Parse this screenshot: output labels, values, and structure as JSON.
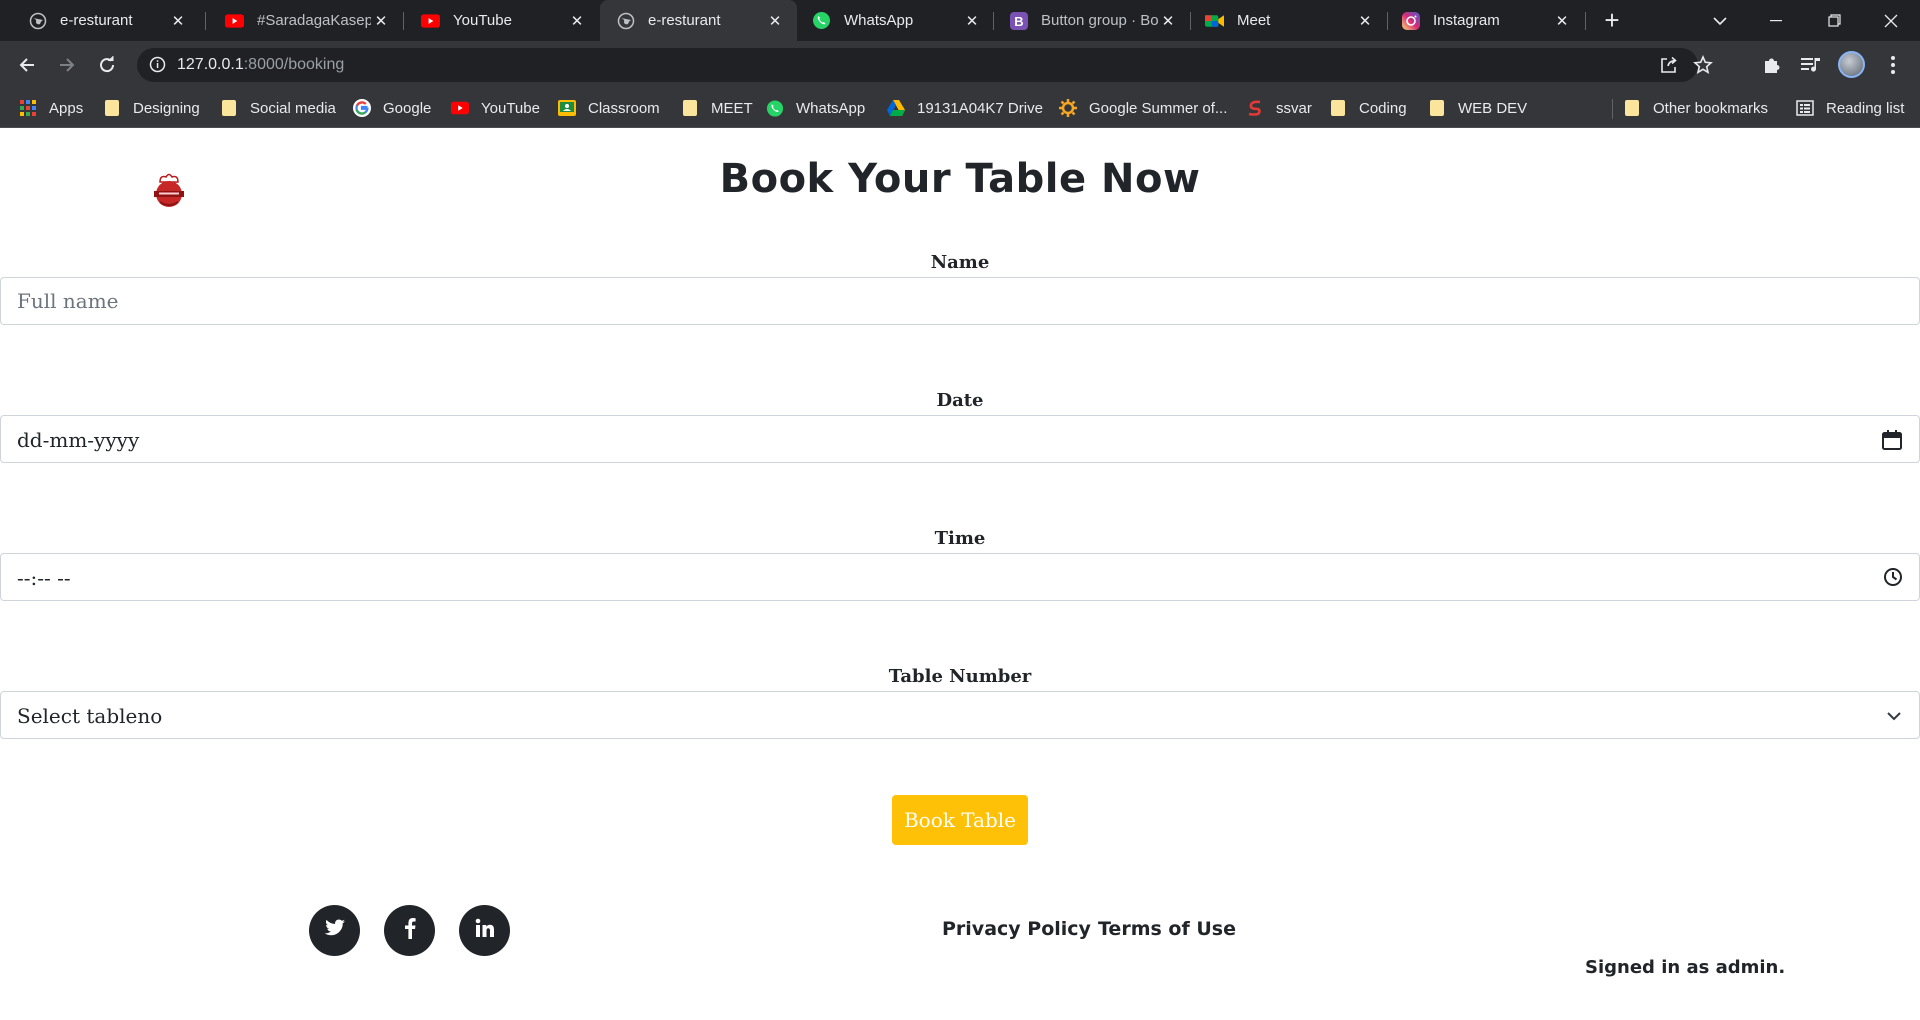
{
  "browser": {
    "tabs": [
      {
        "title": "e-resturant",
        "icon": "globe-icon"
      },
      {
        "title": "#SaradagaKasepa",
        "icon": "youtube-icon"
      },
      {
        "title": "YouTube",
        "icon": "youtube-icon"
      },
      {
        "title": "e-resturant",
        "icon": "globe-icon",
        "active": true
      },
      {
        "title": "WhatsApp",
        "icon": "whatsapp-icon"
      },
      {
        "title": "Button group · Bo",
        "icon": "bootstrap-icon"
      },
      {
        "title": "Meet",
        "icon": "meet-icon"
      },
      {
        "title": "Instagram",
        "icon": "instagram-icon"
      }
    ],
    "url_host": "127.0.0.1",
    "url_rest": ":8000/booking",
    "bookmarks": [
      {
        "label": "Apps",
        "icon": "apps-grid-icon"
      },
      {
        "label": "Designing",
        "icon": "folder-icon"
      },
      {
        "label": "Social media",
        "icon": "folder-icon"
      },
      {
        "label": "Google",
        "icon": "google-icon"
      },
      {
        "label": "YouTube",
        "icon": "youtube-icon"
      },
      {
        "label": "Classroom",
        "icon": "classroom-icon"
      },
      {
        "label": "MEET",
        "icon": "folder-icon"
      },
      {
        "label": "WhatsApp",
        "icon": "whatsapp-icon"
      },
      {
        "label": "19131A04K7 Drive",
        "icon": "drive-icon"
      },
      {
        "label": "Google Summer of...",
        "icon": "gsoc-icon"
      },
      {
        "label": "ssvar",
        "icon": "ssvar-icon"
      },
      {
        "label": "Coding",
        "icon": "folder-icon"
      },
      {
        "label": "WEB DEV",
        "icon": "folder-icon"
      }
    ],
    "other_bookmarks": "Other bookmarks",
    "reading_list": "Reading list"
  },
  "page": {
    "title": "Book Your Table Now",
    "form": {
      "name_label": "Name",
      "name_placeholder": "Full name",
      "date_label": "Date",
      "date_value": "dd-mm-yyyy",
      "time_label": "Time",
      "time_value": "--:-- --",
      "table_label": "Table Number",
      "table_value": "Select tableno",
      "submit_label": "Book Table"
    },
    "footer": {
      "social": [
        "twitter-icon",
        "facebook-icon",
        "linkedin-icon"
      ],
      "links": [
        "Privacy Policy",
        "Terms of Use"
      ],
      "signed_in": "Signed in as admin."
    }
  },
  "colors": {
    "accent": "#ffc107",
    "text": "#212529",
    "chrome_dark": "#202124",
    "chrome": "#35363a"
  }
}
